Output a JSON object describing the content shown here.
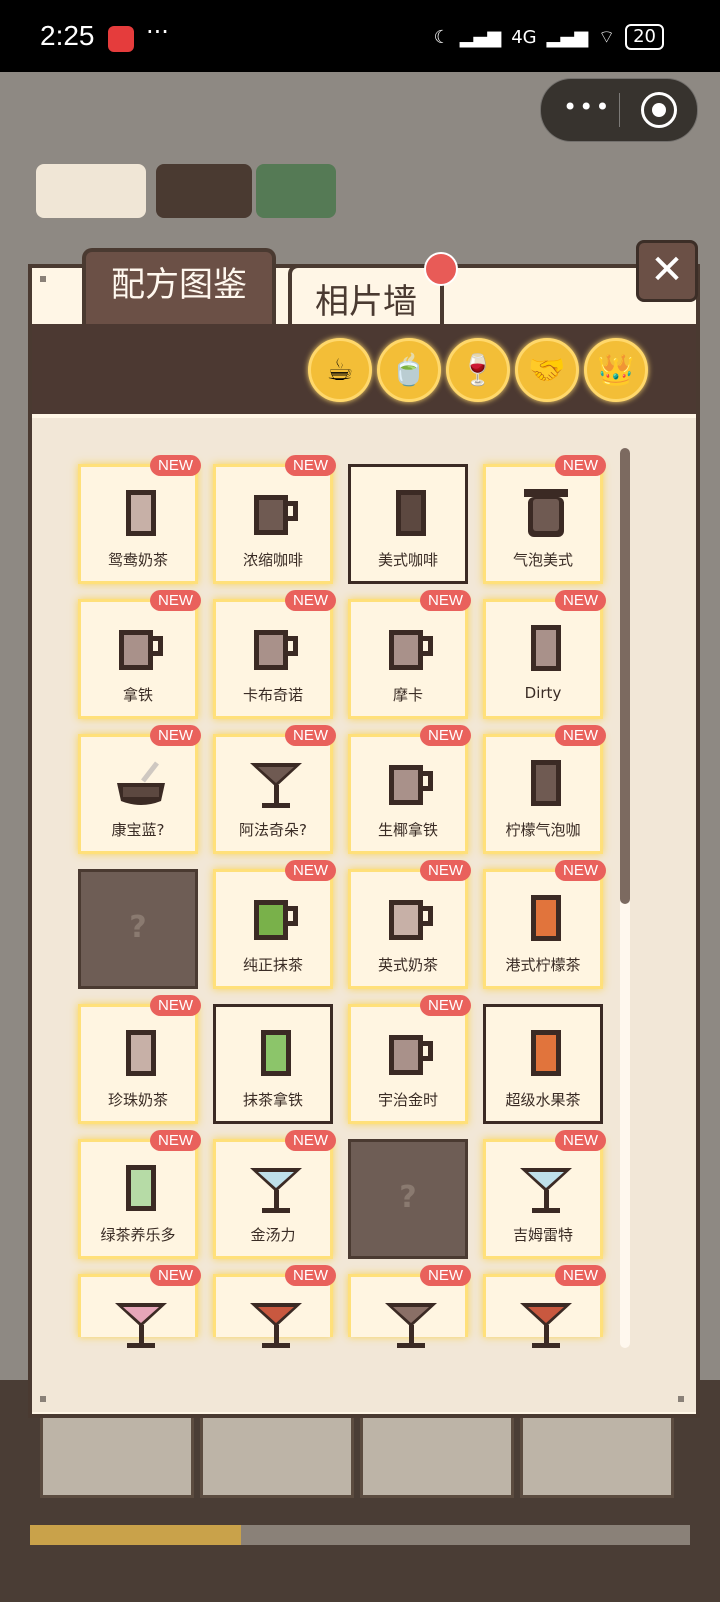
{
  "status": {
    "time": "2:25",
    "dots": "···",
    "network": "4G",
    "battery": "20"
  },
  "capsule": {
    "more": "•••"
  },
  "modal": {
    "tabs": [
      {
        "label": "配方图鉴",
        "active": true
      },
      {
        "label": "相片墙",
        "active": false
      }
    ],
    "close": "✕",
    "categories": [
      {
        "icon": "coffee-cup-icon",
        "glyph": "☕"
      },
      {
        "icon": "tea-cup-icon",
        "glyph": "🍵"
      },
      {
        "icon": "wine-glass-icon",
        "glyph": "🍷"
      },
      {
        "icon": "handshake-icon",
        "glyph": "🤝"
      },
      {
        "icon": "crown-icon",
        "glyph": "👑"
      }
    ],
    "new_label": "NEW",
    "locked_label": "?",
    "recipes": [
      {
        "name": "鸳鸯奶茶",
        "new": true,
        "icon": "tall",
        "color": "#c7b0a7"
      },
      {
        "name": "浓缩咖啡",
        "new": true,
        "icon": "mug",
        "color": "#6f5a52"
      },
      {
        "name": "美式咖啡",
        "new": false,
        "icon": "tall",
        "color": "#5c4840"
      },
      {
        "name": "气泡美式",
        "new": true,
        "icon": "jar",
        "color": "#6f5a52"
      },
      {
        "name": "拿铁",
        "new": true,
        "icon": "mug",
        "color": "#a9918a"
      },
      {
        "name": "卡布奇诺",
        "new": true,
        "icon": "mug",
        "color": "#a9918a"
      },
      {
        "name": "摩卡",
        "new": true,
        "icon": "mug",
        "color": "#a9918a"
      },
      {
        "name": "Dirty",
        "new": true,
        "icon": "tall",
        "color": "#a9918a"
      },
      {
        "name": "康宝蓝?",
        "new": true,
        "icon": "bowl",
        "color": "#5c4840"
      },
      {
        "name": "阿法奇朵?",
        "new": true,
        "icon": "martini",
        "color": "#6f5a52"
      },
      {
        "name": "生椰拿铁",
        "new": true,
        "icon": "mug",
        "color": "#a9918a"
      },
      {
        "name": "柠檬气泡咖",
        "new": true,
        "icon": "tall",
        "color": "#6f5a52"
      },
      {
        "locked": true
      },
      {
        "name": "纯正抹茶",
        "new": true,
        "icon": "mug",
        "color": "#79b14a"
      },
      {
        "name": "英式奶茶",
        "new": true,
        "icon": "mug",
        "color": "#c7b0a7"
      },
      {
        "name": "港式柠檬茶",
        "new": true,
        "icon": "tall",
        "color": "#e1743c"
      },
      {
        "name": "珍珠奶茶",
        "new": true,
        "icon": "tall",
        "color": "#c7b0a7"
      },
      {
        "name": "抹茶拿铁",
        "new": false,
        "icon": "tall",
        "color": "#8cc56a"
      },
      {
        "name": "宇治金时",
        "new": true,
        "icon": "mug",
        "color": "#a9918a"
      },
      {
        "name": "超级水果茶",
        "new": false,
        "icon": "tall",
        "color": "#e1743c"
      },
      {
        "name": "绿茶养乐多",
        "new": true,
        "icon": "tall",
        "color": "#b6dba6"
      },
      {
        "name": "金汤力",
        "new": true,
        "icon": "martini",
        "color": "#bfe0ea"
      },
      {
        "locked": true
      },
      {
        "name": "吉姆雷特",
        "new": true,
        "icon": "martini",
        "color": "#bfe0ea"
      },
      {
        "name": "",
        "new": true,
        "icon": "martini",
        "color": "#e7a6b9"
      },
      {
        "name": "",
        "new": true,
        "icon": "martini",
        "color": "#c9583f"
      },
      {
        "name": "",
        "new": true,
        "icon": "martini",
        "color": "#8a6f66"
      },
      {
        "name": "",
        "new": true,
        "icon": "martini",
        "color": "#c9583f"
      }
    ]
  },
  "progress": {
    "fraction": 0.32
  }
}
